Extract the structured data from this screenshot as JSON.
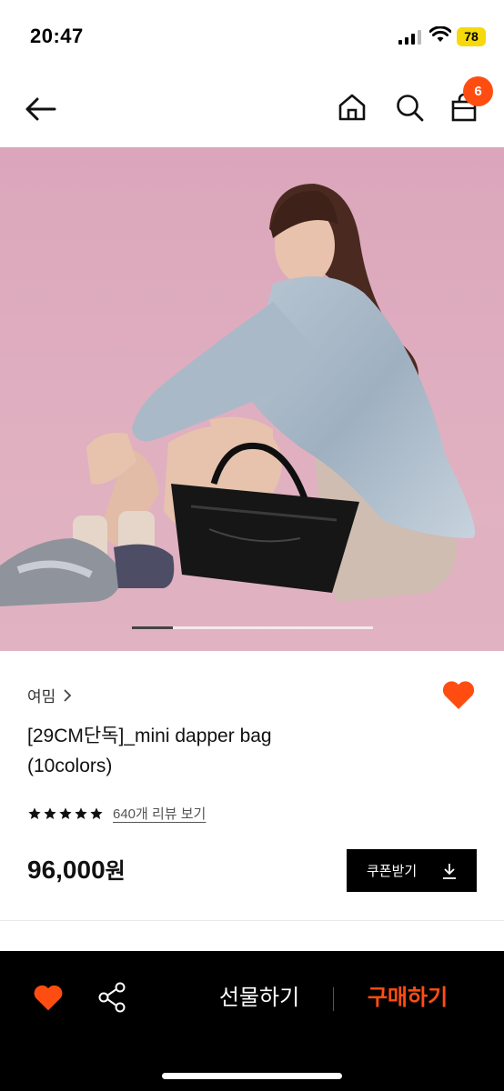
{
  "status_bar": {
    "time": "20:47",
    "battery": "78",
    "battery_color": "#f5d90a"
  },
  "nav": {
    "back_icon": "arrow-left-icon",
    "home_icon": "home-icon",
    "search_icon": "search-icon",
    "cart_icon": "shopping-bag-icon",
    "cart_count": "6",
    "badge_color": "#ff4d12"
  },
  "carousel": {
    "progress": 0.17
  },
  "product": {
    "brand": "여밈",
    "title_line1": "[29CM단독]_mini dapper bag",
    "title_line2": "(10colors)",
    "rating_stars": 5,
    "review_link": "640개 리뷰 보기",
    "price": "96,000",
    "price_unit": "원",
    "coupon_label": "쿠폰받기",
    "coupon_icon": "download-icon",
    "like_icon": "heart-icon",
    "accent_color": "#ff4d12"
  },
  "bottom_bar": {
    "like_icon": "heart-icon",
    "share_icon": "share-icon",
    "gift_label": "선물하기",
    "buy_label": "구매하기"
  }
}
